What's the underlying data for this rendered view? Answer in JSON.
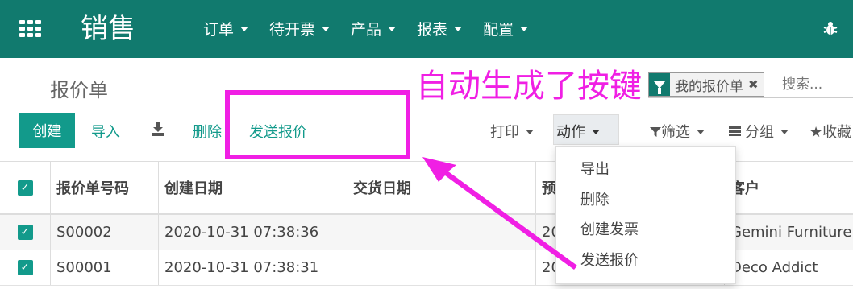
{
  "navbar": {
    "brand": "销售",
    "menu": [
      "订单",
      "待开票",
      "产品",
      "报表",
      "配置"
    ]
  },
  "page": {
    "title": "报价单"
  },
  "search": {
    "facet_label": "我的报价单",
    "placeholder": "搜索..."
  },
  "toolbar": {
    "create": "创建",
    "import": "导入",
    "delete": "删除",
    "send_quote": "发送报价",
    "print": "打印",
    "action": "动作",
    "filter": "筛选",
    "group": "分组",
    "favorites": "收藏"
  },
  "table": {
    "columns": [
      "报价单号码",
      "创建日期",
      "交货日期",
      "预",
      "客户"
    ],
    "rows": [
      {
        "number": "S00002",
        "created": "2020-10-31 07:38:36",
        "delivery": "",
        "expected": "20",
        "customer": "Gemini Furniture",
        "checked": true
      },
      {
        "number": "S00001",
        "created": "2020-10-31 07:38:31",
        "delivery": "",
        "expected": "20",
        "customer": "Deco Addict",
        "checked": true
      }
    ]
  },
  "action_menu": {
    "items": [
      "导出",
      "删除",
      "创建发票",
      "发送报价"
    ]
  },
  "annotation": {
    "text": "自动生成了按键",
    "color": "#f01fe4"
  },
  "colors": {
    "navbar": "#117a6e",
    "primary": "#129a8b"
  },
  "icons": {
    "apps": "apps-grid-icon",
    "debug": "bug-icon",
    "download": "download-icon",
    "filter": "funnel-icon",
    "group": "list-icon",
    "favorites": "star-icon"
  }
}
